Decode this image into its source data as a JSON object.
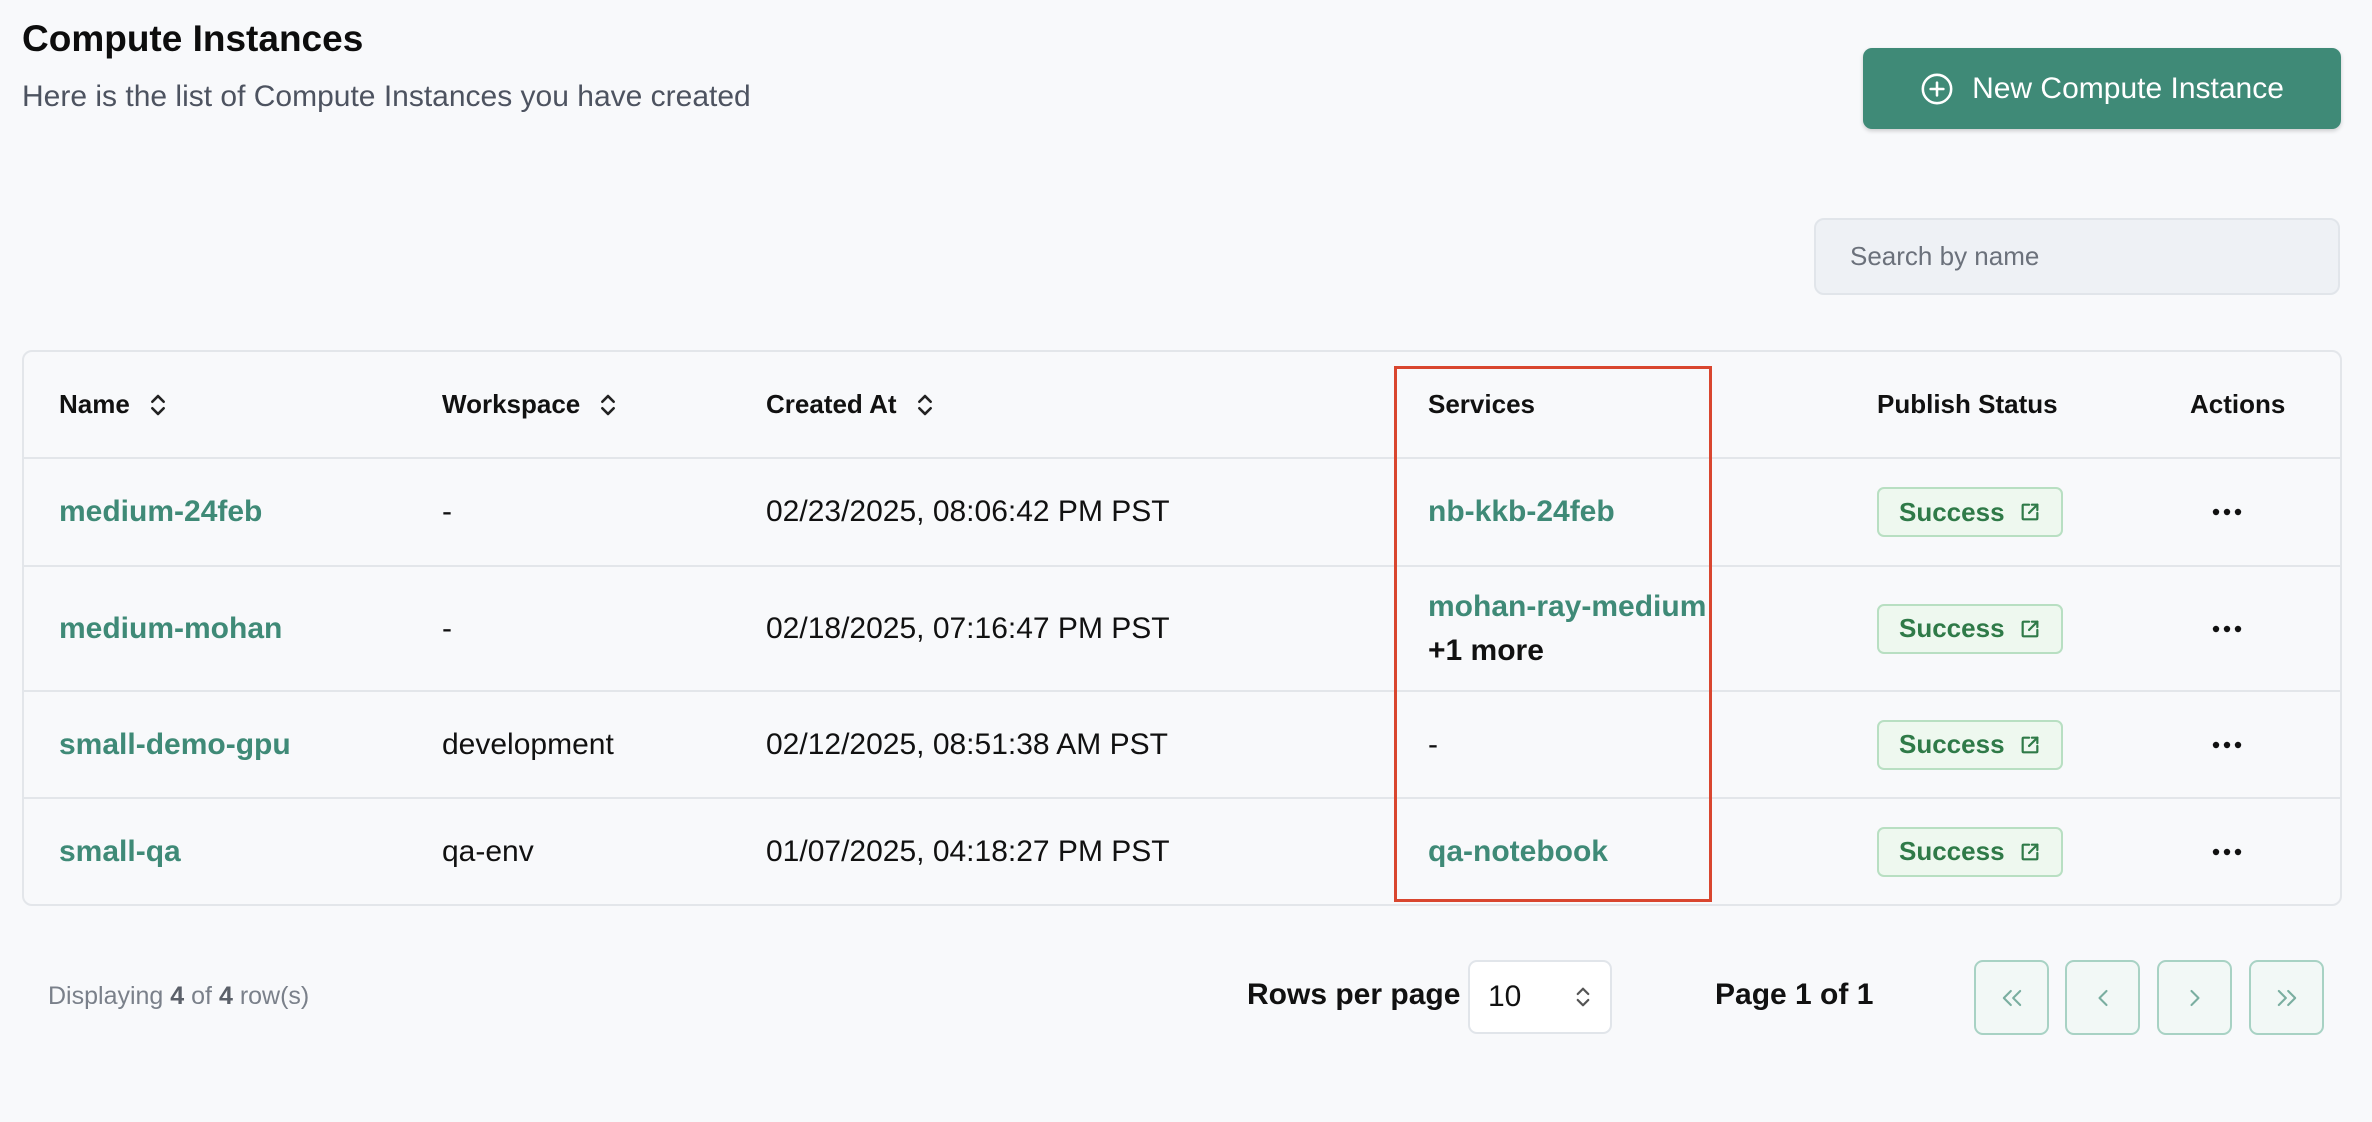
{
  "header": {
    "title": "Compute Instances",
    "subtitle": "Here is the list of Compute Instances you have created",
    "new_button_label": "New Compute Instance"
  },
  "search": {
    "placeholder": "Search by name",
    "value": ""
  },
  "table": {
    "columns": {
      "name": "Name",
      "workspace": "Workspace",
      "created_at": "Created At",
      "services": "Services",
      "publish_status": "Publish Status",
      "actions": "Actions"
    },
    "rows": [
      {
        "name": "medium-24feb",
        "workspace": "-",
        "created_at": "02/23/2025, 08:06:42 PM PST",
        "service": "nb-kkb-24feb",
        "service_more": "",
        "status": "Success"
      },
      {
        "name": "medium-mohan",
        "workspace": "-",
        "created_at": "02/18/2025, 07:16:47 PM PST",
        "service": "mohan-ray-medium",
        "service_more": "+1 more",
        "status": "Success"
      },
      {
        "name": "small-demo-gpu",
        "workspace": "development",
        "created_at": "02/12/2025, 08:51:38 AM PST",
        "service": "-",
        "service_more": "",
        "status": "Success"
      },
      {
        "name": "small-qa",
        "workspace": "qa-env",
        "created_at": "01/07/2025, 04:18:27 PM PST",
        "service": "qa-notebook",
        "service_more": "",
        "status": "Success"
      }
    ]
  },
  "footer": {
    "display_prefix": "Displaying",
    "display_count": "4",
    "display_of": "of",
    "display_total": "4",
    "display_suffix": "row(s)",
    "rows_per_page_label": "Rows per page",
    "rows_per_page_value": "10",
    "page_info": "Page 1 of 1"
  },
  "colors": {
    "accent": "#3f8a77",
    "success_bg": "#eef8ef",
    "success_text": "#2f7a48",
    "highlight": "#d9462f"
  },
  "icons": {
    "new_button": "plus-circle-icon",
    "sort": "sort-icon",
    "status": "external-link-icon",
    "actions": "more-horizontal-icon",
    "pagination": [
      "first-page-icon",
      "prev-page-icon",
      "next-page-icon",
      "last-page-icon"
    ]
  }
}
